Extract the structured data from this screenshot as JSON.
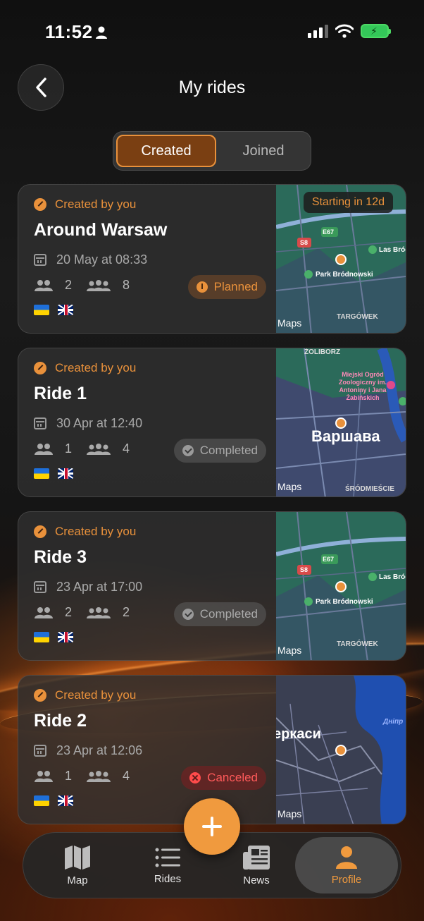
{
  "status_bar": {
    "time": "11:52"
  },
  "header": {
    "title": "My rides"
  },
  "segment": {
    "created": "Created",
    "joined": "Joined"
  },
  "rides": [
    {
      "created_label": "Created by you",
      "title": "Around Warsaw",
      "date": "20 May at 08:33",
      "participants": "2",
      "capacity": "8",
      "status": "Planned",
      "starting_chip": "Starting in 12d",
      "map": {
        "maps_label": "Maps",
        "labels": [
          "S8",
          "E67",
          "Las Bróc",
          "Park Bródnowski",
          "TARGÓWEK"
        ]
      }
    },
    {
      "created_label": "Created by you",
      "title": "Ride 1",
      "date": "30 Apr at 12:40",
      "participants": "1",
      "capacity": "4",
      "status": "Completed",
      "map": {
        "maps_label": "Maps",
        "labels": [
          "ŻOLIBORZ",
          "Miejski Ogród Zoologiczny im. Antoniny i Jana Żabińskich",
          "Варшава",
          "ŚRÓDMIEŚCIE"
        ]
      }
    },
    {
      "created_label": "Created by you",
      "title": "Ride 3",
      "date": "23 Apr at 17:00",
      "participants": "2",
      "capacity": "2",
      "status": "Completed",
      "map": {
        "maps_label": "Maps",
        "labels": [
          "S8",
          "E67",
          "Las Bróc",
          "Park Bródnowski",
          "TARGÓWEK"
        ]
      }
    },
    {
      "created_label": "Created by you",
      "title": "Ride 2",
      "date": "23 Apr at 12:06",
      "participants": "1",
      "capacity": "4",
      "status": "Canceled",
      "map": {
        "maps_label": "Maps",
        "labels": [
          "еркаси",
          "Дніпр"
        ]
      }
    }
  ],
  "tabbar": {
    "map": "Map",
    "rides": "Rides",
    "news": "News",
    "profile": "Profile"
  },
  "colors": {
    "accent": "#f09a3e",
    "canceled": "#ff4b4b",
    "card": "#303030"
  }
}
